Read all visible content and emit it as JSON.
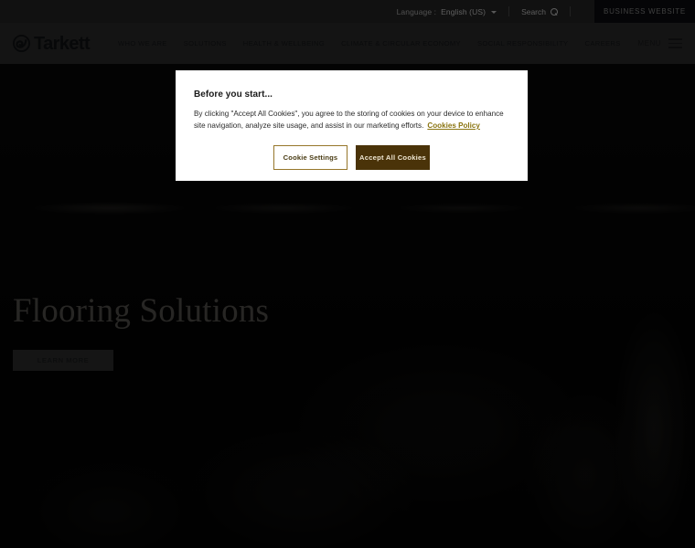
{
  "topbar": {
    "language_label": "Language :",
    "language_value": "English (US)",
    "search_label": "Search",
    "search_icon": "search-icon",
    "chevron_icon": "chevron-down-icon",
    "business_website_label": "BUSINESS WEBSITE"
  },
  "header": {
    "logo_text": "Tarkett",
    "logo_icon": "tarkett-swirl-icon",
    "nav": [
      {
        "label": "WHO WE ARE"
      },
      {
        "label": "SOLUTIONS"
      },
      {
        "label": "HEALTH & WELLBEING"
      },
      {
        "label": "CLIMATE & CIRCULAR ECONOMY"
      },
      {
        "label": "SOCIAL RESPONSIBILITY"
      },
      {
        "label": "CAREERS"
      }
    ],
    "menu_label": "MENU",
    "menu_icon": "hamburger-icon"
  },
  "hero": {
    "title": "Flooring Solutions",
    "cta_label": "LEARN MORE"
  },
  "cookie_modal": {
    "title": "Before you start...",
    "body": "By clicking \"Accept All Cookies\", you agree to the storing of cookies on your device to enhance site navigation, analyze site usage, and assist in our marketing efforts.",
    "policy_link": "Cookies Policy",
    "settings_label": "Cookie Settings",
    "accept_label": "Accept All Cookies"
  },
  "colors": {
    "topbar_bg": "#262626",
    "header_bg": "#2e2e2e",
    "business_btn_bg": "#0c0d10",
    "accent_gold": "#96762a",
    "accept_btn_bg": "#4a3309",
    "link_gold": "#8a7410",
    "hero_title": "#585551",
    "overlay": "rgba(0,0,0,0.55)"
  }
}
